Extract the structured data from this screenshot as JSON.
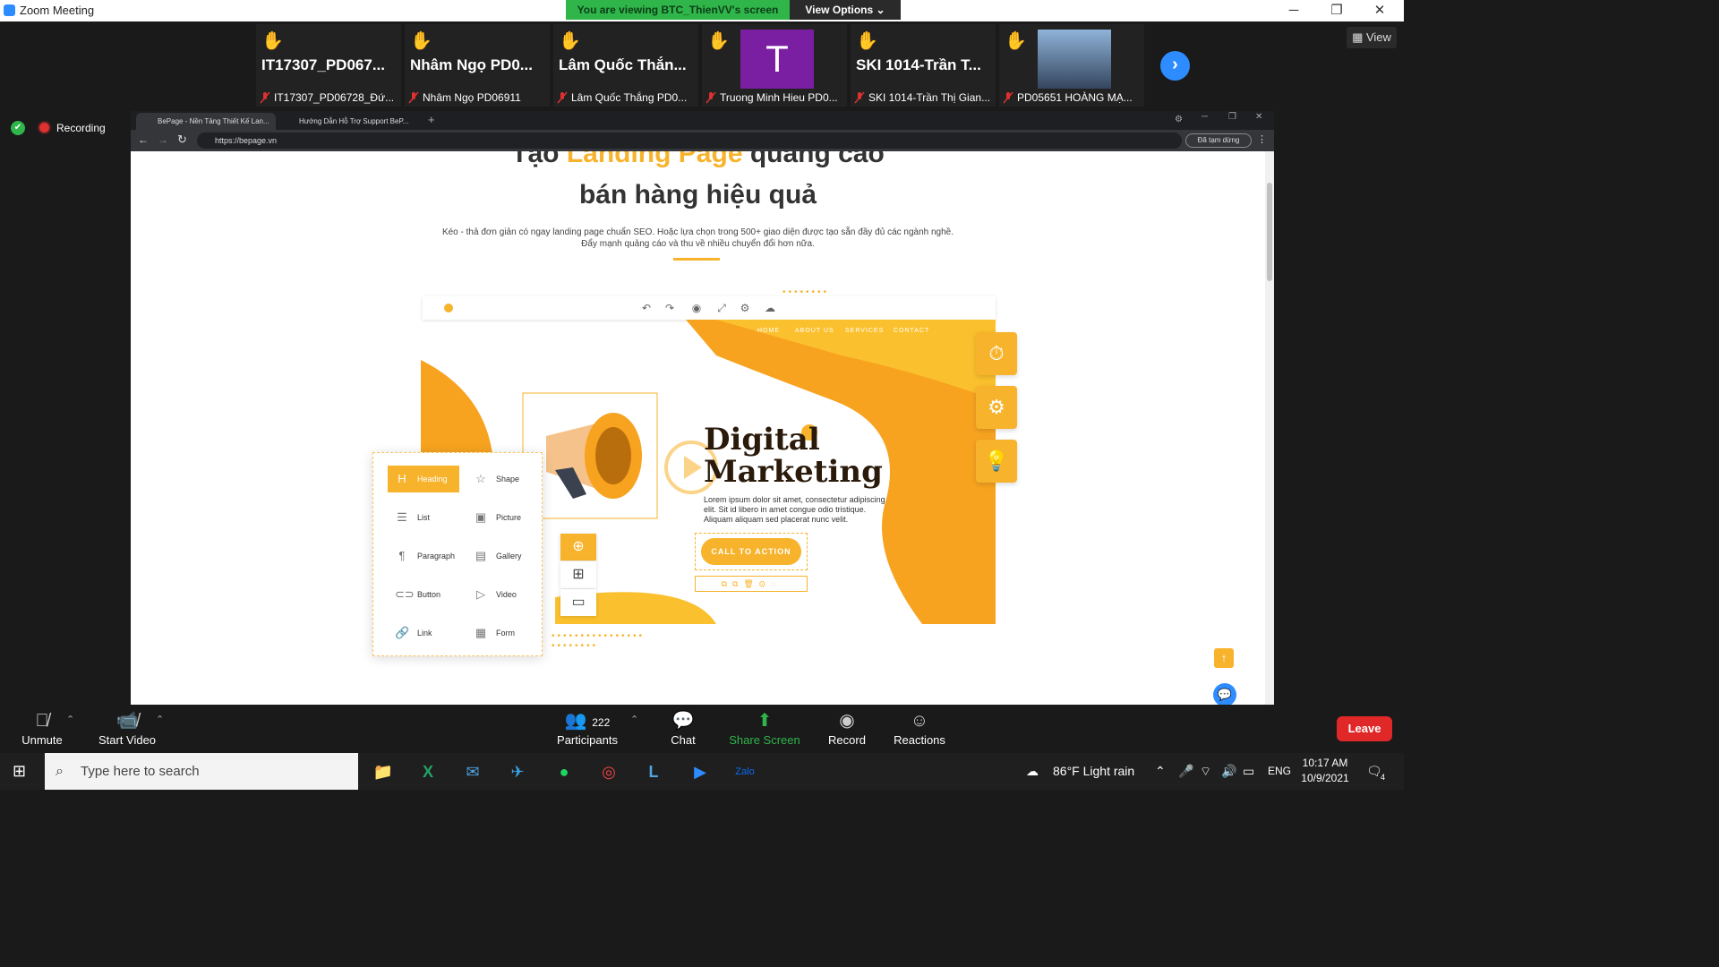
{
  "window": {
    "title": "Zoom Meeting"
  },
  "banner": {
    "text": "You are viewing BTC_ThienVV's screen",
    "view_options": "View Options"
  },
  "participants": [
    {
      "big": "IT17307_PD067...",
      "name": "IT17307_PD06728_Đứ..."
    },
    {
      "big": "Nhâm Ngọ PD0...",
      "name": "Nhâm Ngọ PD06911"
    },
    {
      "big": "Lâm Quốc Thắn...",
      "name": "Lâm Quốc Thắng PD0..."
    },
    {
      "big": "T",
      "name": "Truong Minh Hieu PD0..."
    },
    {
      "big": "SKI 1014-Trần T...",
      "name": "SKI 1014-Trần Thị Gian..."
    },
    {
      "big": "",
      "name": "PD05651 HOÀNG MẠ..."
    }
  ],
  "view_label": "View",
  "recording_label": "Recording",
  "browser": {
    "tabs": [
      "BePage - Nền Tảng Thiết Kế Lan...",
      "Hướng Dẫn Hỗ Trợ Support BeP..."
    ],
    "url": "https://bepage.vn",
    "profile": "Đã tạm dừng"
  },
  "hero": {
    "title_line1_pre": "Tạo ",
    "title_highlight": "Landing Page",
    "title_line1_post": " quảng cáo",
    "title_line2": "bán hàng hiệu quả",
    "desc_line1": "Kéo - thả đơn giản có ngay landing page chuẩn SEO. Hoặc lựa chọn trong 500+ giao diện được tạo sẵn đầy đủ các ngành nghề.",
    "desc_line2": "Đẩy mạnh quảng cáo và thu về nhiều chuyển đổi hơn nữa."
  },
  "mock": {
    "nav": [
      "HOME",
      "ABOUT US",
      "SERVICES",
      "CONTACT"
    ],
    "headline1": "Digital",
    "headline2": "Marketing",
    "lorem1": "Lorem ipsum dolor sit amet, consectetur adipiscing",
    "lorem2": "elit. Sit id libero in amet congue odio tristique.",
    "lorem3": "Aliquam aliquam sed placerat nunc velit.",
    "cta": "CALL TO ACTION",
    "blocks": [
      {
        "label": "Heading",
        "icon": "H"
      },
      {
        "label": "Shape",
        "icon": "☆"
      },
      {
        "label": "List",
        "icon": "☰"
      },
      {
        "label": "Picture",
        "icon": "▣"
      },
      {
        "label": "Paragraph",
        "icon": "¶"
      },
      {
        "label": "Gallery",
        "icon": "▤"
      },
      {
        "label": "Button",
        "icon": "⊂⊃"
      },
      {
        "label": "Video",
        "icon": "▷"
      },
      {
        "label": "Link",
        "icon": "🔗"
      },
      {
        "label": "Form",
        "icon": "▦"
      }
    ]
  },
  "zoom_bar": {
    "unmute": "Unmute",
    "start_video": "Start Video",
    "participants": "Participants",
    "participant_count": "222",
    "chat": "Chat",
    "share_screen": "Share Screen",
    "record": "Record",
    "reactions": "Reactions",
    "leave": "Leave"
  },
  "taskbar": {
    "search_placeholder": "Type here to search",
    "weather": "86°F  Light rain",
    "lang": "ENG",
    "time": "10:17 AM",
    "date": "10/9/2021",
    "notif_count": "4"
  },
  "colors": {
    "accent": "#f7b32b",
    "zoom_blue": "#2d8cff",
    "green": "#2fb54a",
    "leave": "#e02828"
  }
}
